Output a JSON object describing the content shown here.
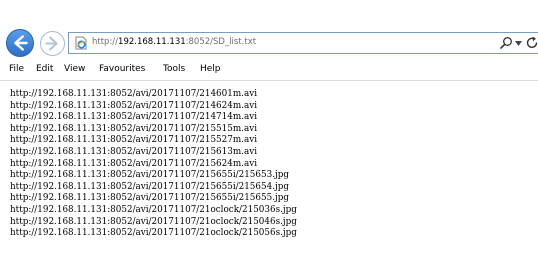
{
  "browser": {
    "address": {
      "scheme": "http://",
      "host": "192.168.11.131",
      "rest": ":8052/SD_list.txt"
    },
    "icons": {
      "back": "back-arrow-icon",
      "forward": "forward-arrow-icon",
      "page": "ie-page-icon",
      "search": "search-icon",
      "dropdown": "chevron-down-icon",
      "refresh": "refresh-icon"
    }
  },
  "menu": {
    "items": [
      {
        "label": "File"
      },
      {
        "label": "Edit"
      },
      {
        "label": "View"
      },
      {
        "label": "Favourites"
      },
      {
        "label": "Tools"
      },
      {
        "label": "Help"
      }
    ]
  },
  "content": {
    "lines": [
      "http://192.168.11.131:8052/avi/20171107/214601m.avi",
      "http://192.168.11.131:8052/avi/20171107/214624m.avi",
      "http://192.168.11.131:8052/avi/20171107/214714m.avi",
      "http://192.168.11.131:8052/avi/20171107/215515m.avi",
      "http://192.168.11.131:8052/avi/20171107/215527m.avi",
      "http://192.168.11.131:8052/avi/20171107/215613m.avi",
      "http://192.168.11.131:8052/avi/20171107/215624m.avi",
      "http://192.168.11.131:8052/avi/20171107/215655i/215653.jpg",
      "http://192.168.11.131:8052/avi/20171107/215655i/215654.jpg",
      "http://192.168.11.131:8052/avi/20171107/215655i/215655.jpg",
      "http://192.168.11.131:8052/avi/20171107/21oclock/215036s.jpg",
      "http://192.168.11.131:8052/avi/20171107/21oclock/215046s.jpg",
      "http://192.168.11.131:8052/avi/20171107/21oclock/215056s.jpg"
    ]
  },
  "colors": {
    "back_button": "#2c6fc6",
    "address_border": "#7a9cc6",
    "url_dim": "#6d6d6d"
  }
}
